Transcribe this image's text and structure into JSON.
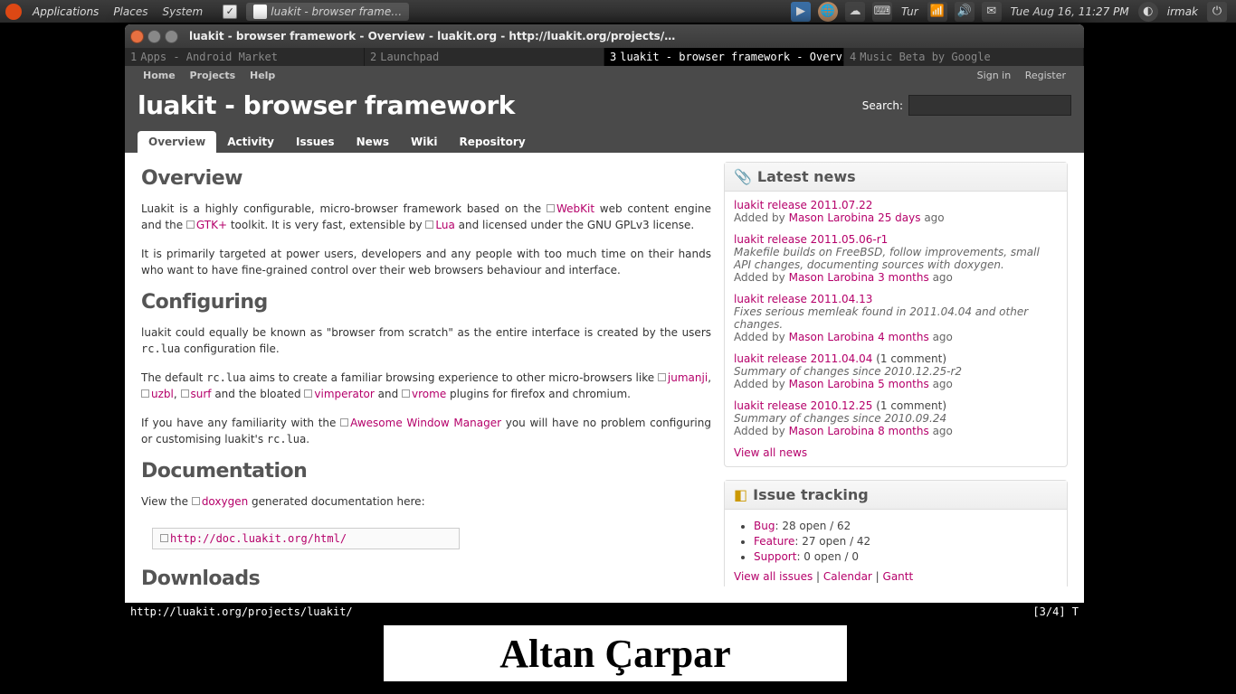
{
  "gnome": {
    "menus": [
      "Applications",
      "Places",
      "System"
    ],
    "window_button": "luakit - browser frame…",
    "tray_text_lang": "Tur",
    "datetime": "Tue Aug 16, 11:27 PM",
    "username": "irmak"
  },
  "window": {
    "title": "luakit - browser framework - Overview - luakit.org - http://luakit.org/projects/…"
  },
  "tabs": [
    {
      "num": "1",
      "label": "Apps - Android Market",
      "active": false
    },
    {
      "num": "2",
      "label": "Launchpad",
      "active": false
    },
    {
      "num": "3",
      "label": "luakit - browser framework - Overvi",
      "active": true
    },
    {
      "num": "4",
      "label": "Music Beta by Google",
      "active": false
    }
  ],
  "header": {
    "links": [
      "Home",
      "Projects",
      "Help"
    ],
    "auth": [
      "Sign in",
      "Register"
    ],
    "title": "luakit - browser framework",
    "search_label": "Search:"
  },
  "project_tabs": [
    "Overview",
    "Activity",
    "Issues",
    "News",
    "Wiki",
    "Repository"
  ],
  "overview": {
    "heading": "Overview",
    "p1a": "Luakit is a highly configurable, micro-browser framework based on the ",
    "p1_webkit": "WebKit",
    "p1b": " web content engine and the ",
    "p1_gtk": "GTK+",
    "p1c": " toolkit. It is very fast, extensible by ",
    "p1_lua": "Lua",
    "p1d": " and licensed under the GNU GPLv3 license.",
    "p2": "It is primarily targeted at power users, developers and any people with too much time on their hands who want to have fine-grained control over their web browsers behaviour and interface.",
    "h_conf": "Configuring",
    "p3a": "luakit could equally be known as \"browser from scratch\" as the entire interface is created by the users ",
    "p3_code": "rc.lua",
    "p3b": " configuration file.",
    "p4a": "The default ",
    "p4_code": "rc.lua",
    "p4b": " aims to create a familiar browsing experience to other micro-browsers like ",
    "p4_jumanji": "jumanji",
    "p4c": ", ",
    "p4_uzbl": "uzbl",
    "p4d": ", ",
    "p4_surf": "surf",
    "p4e": " and the bloated ",
    "p4_vimp": "vimperator",
    "p4f": " and ",
    "p4_vrome": "vrome",
    "p4g": " plugins for firefox and chromium.",
    "p5a": "If you have any familiarity with the ",
    "p5_awesome": "Awesome Window Manager",
    "p5b": " you will have no problem configuring or customising luakit's ",
    "p5_code": "rc.lua",
    "p5c": ".",
    "h_doc": "Documentation",
    "doc_a": "View the ",
    "doc_link": "doxygen",
    "doc_b": " generated documentation here:",
    "doc_url": "http://doc.luakit.org/html/",
    "h_down": "Downloads"
  },
  "news": {
    "heading": "Latest news",
    "items": [
      {
        "title": "luakit release 2011.07.22",
        "desc": "",
        "author": "Mason Larobina",
        "age": "25 days"
      },
      {
        "title": "luakit release 2011.05.06-r1",
        "desc": "Makefile builds on FreeBSD, follow improvements, small API changes, documenting sources with doxygen.",
        "author": "Mason Larobina",
        "age": "3 months"
      },
      {
        "title": "luakit release 2011.04.13",
        "desc": "Fixes serious memleak found in 2011.04.04 and other changes.",
        "author": "Mason Larobina",
        "age": "4 months"
      },
      {
        "title": "luakit release 2011.04.04",
        "comment": "(1 comment)",
        "desc": "Summary of changes since 2010.12.25-r2",
        "author": "Mason Larobina",
        "age": "5 months"
      },
      {
        "title": "luakit release 2010.12.25",
        "comment": "(1 comment)",
        "desc": "Summary of changes since 2010.09.24",
        "author": "Mason Larobina",
        "age": "8 months"
      }
    ],
    "added_by": "Added by ",
    "ago": " ago",
    "view_all": "View all news"
  },
  "issues": {
    "heading": "Issue tracking",
    "items": [
      {
        "label": "Bug",
        "stats": ": 28 open / 62"
      },
      {
        "label": "Feature",
        "stats": ": 27 open / 42"
      },
      {
        "label": "Support",
        "stats": ": 0 open / 0"
      }
    ],
    "view_all": "View all issues",
    "calendar": "Calendar",
    "gantt": "Gantt",
    "sep": " | "
  },
  "status": {
    "url": "http://luakit.org/projects/luakit/",
    "right": "[3/4] T"
  },
  "overlay_text": "Altan Çarpar"
}
